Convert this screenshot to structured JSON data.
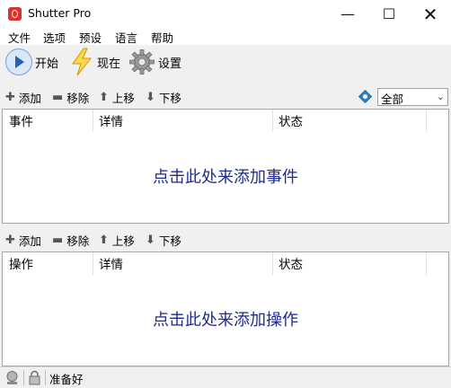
{
  "window": {
    "title": "Shutter Pro",
    "controls": {
      "minimize": "—",
      "maximize": "☐",
      "close": "✕"
    }
  },
  "menu": [
    {
      "label": "文件"
    },
    {
      "label": "选项"
    },
    {
      "label": "预设"
    },
    {
      "label": "语言"
    },
    {
      "label": "帮助"
    }
  ],
  "toolbar": {
    "start_label": "开始",
    "now_label": "现在",
    "settings_label": "设置"
  },
  "events_bar": {
    "add_label": "添加",
    "remove_label": "移除",
    "up_label": "上移",
    "down_label": "下移",
    "filter_value": "全部"
  },
  "events_table": {
    "columns": [
      {
        "label": "事件"
      },
      {
        "label": "详情"
      },
      {
        "label": "状态"
      }
    ],
    "empty_hint": "点击此处来添加事件"
  },
  "actions_bar": {
    "add_label": "添加",
    "remove_label": "移除",
    "up_label": "上移",
    "down_label": "下移"
  },
  "actions_table": {
    "columns": [
      {
        "label": "操作"
      },
      {
        "label": "详情"
      },
      {
        "label": "状态"
      }
    ],
    "empty_hint": "点击此处来添加操作"
  },
  "statusbar": {
    "status_text": "准备好"
  },
  "colors": {
    "hint_text": "#1f2a8f",
    "app_icon": "#d9342b",
    "start_icon": "#245fbd"
  }
}
